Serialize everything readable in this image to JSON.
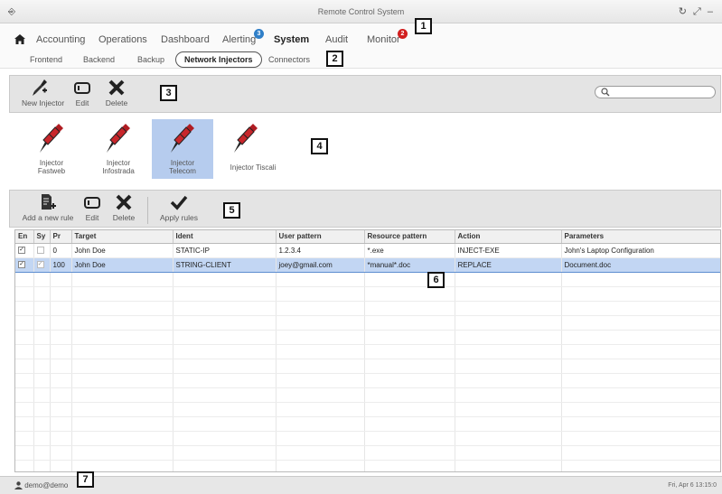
{
  "window": {
    "title": "Remote Control System",
    "app_icon": "app-icon",
    "controls_glyph": "↻ ⤢ –"
  },
  "main_nav": {
    "items": [
      {
        "label": "Accounting"
      },
      {
        "label": "Operations"
      },
      {
        "label": "Dashboard"
      },
      {
        "label": "Alerting",
        "badge": "3"
      },
      {
        "label": "System",
        "active": true
      },
      {
        "label": "Audit"
      },
      {
        "label": "Monitor",
        "badge": "2"
      }
    ]
  },
  "sub_nav": {
    "items": [
      {
        "label": "Frontend"
      },
      {
        "label": "Backend"
      },
      {
        "label": "Backup"
      },
      {
        "label": "Network Injectors",
        "active": true
      },
      {
        "label": "Connectors"
      }
    ]
  },
  "injector_toolbar": {
    "new_label": "New Injector",
    "edit_label": "Edit",
    "delete_label": "Delete",
    "search_placeholder": ""
  },
  "injectors": [
    {
      "line1": "Injector",
      "line2": "Fastweb"
    },
    {
      "line1": "Injector",
      "line2": "Infostrada"
    },
    {
      "line1": "Injector",
      "line2": "Telecom",
      "selected": true
    },
    {
      "line1": "Injector Tiscali",
      "line2": ""
    }
  ],
  "rules_toolbar": {
    "add_label": "Add a new rule",
    "edit_label": "Edit",
    "delete_label": "Delete",
    "apply_label": "Apply rules"
  },
  "rules_table": {
    "headers": {
      "en": "En",
      "sy": "Sy",
      "pr": "Pr",
      "target": "Target",
      "ident": "Ident",
      "user_pattern": "User pattern",
      "resource_pattern": "Resource pattern",
      "action": "Action",
      "parameters": "Parameters"
    },
    "rows": [
      {
        "en": true,
        "sy": false,
        "pr": "0",
        "target": "John Doe",
        "ident": "STATIC-IP",
        "user_pattern": "1.2.3.4",
        "resource_pattern": "*.exe",
        "action": "INJECT-EXE",
        "parameters": "John's Laptop Configuration"
      },
      {
        "en": true,
        "sy": true,
        "pr": "100",
        "target": "John Doe",
        "ident": "STRING-CLIENT",
        "user_pattern": "joey@gmail.com",
        "resource_pattern": "*manual*.doc",
        "action": "REPLACE",
        "parameters": "Document.doc",
        "selected": true
      }
    ]
  },
  "status": {
    "user": "demo@demo",
    "time": "Fri, Apr 6   13:15:0"
  },
  "callouts": [
    "1",
    "2",
    "3",
    "4",
    "5",
    "6",
    "7"
  ],
  "colors": {
    "selection": "#b6ccee",
    "badge_blue": "#2f7fc8",
    "badge_red": "#d21f1f",
    "injector_red": "#c8262b"
  }
}
